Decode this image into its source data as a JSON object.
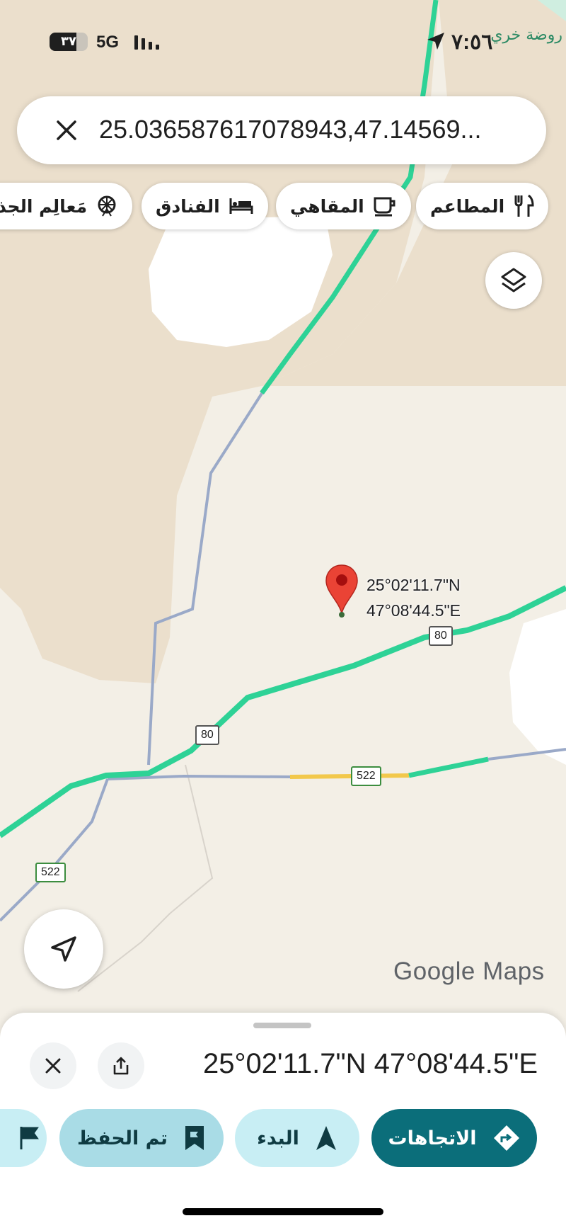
{
  "status_bar": {
    "battery": "٣٧",
    "network": "5G",
    "time": "٧:٥٦"
  },
  "search": {
    "query": "25.036587617078943,47.14569..."
  },
  "chips": [
    {
      "label": "المطاعم",
      "icon": "restaurant-icon"
    },
    {
      "label": "المقاهي",
      "icon": "coffee-icon"
    },
    {
      "label": "الفنادق",
      "icon": "hotel-icon"
    },
    {
      "label": "مَعالِم الجذ",
      "icon": "attractions-icon"
    }
  ],
  "map": {
    "pin_label_lat": "25°02'11.7\"N",
    "pin_label_lng": "47°08'44.5\"E",
    "route_shields": [
      "80",
      "80",
      "522",
      "522"
    ],
    "place_label": "روضة خري",
    "logo_text": "Google Maps"
  },
  "sheet": {
    "coordinates": "25°02'11.7\"N 47°08'44.5\"E",
    "buttons": {
      "directions": "الاتجاهات",
      "start": "البدء",
      "saved": "تم الحفظ"
    }
  },
  "colors": {
    "road_green": "#2ed296",
    "road_minor": "#9aa9c8",
    "primary": "#0b6e7a",
    "pin_red": "#ea4335"
  }
}
